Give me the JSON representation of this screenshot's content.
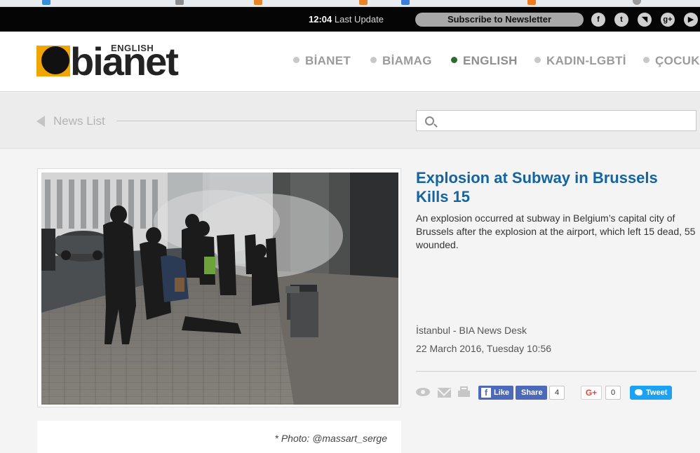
{
  "topbar": {
    "time": "12:04",
    "last_update": "Last Update",
    "subscribe": "Subscribe to Newsletter",
    "social": [
      {
        "name": "facebook-icon",
        "glyph": "f"
      },
      {
        "name": "twitter-icon",
        "glyph": "t"
      },
      {
        "name": "rss-icon",
        "glyph": "◥"
      },
      {
        "name": "googleplus-icon",
        "glyph": "g+"
      },
      {
        "name": "youtube-icon",
        "glyph": "▶"
      }
    ]
  },
  "logo": {
    "edition": "ENGLISH",
    "word": "bianet"
  },
  "nav": [
    "BİANET",
    "BİAMAG",
    "ENGLISH",
    "KADIN-LGBTİ",
    "ÇOCUK"
  ],
  "nav_active": "ENGLISH",
  "newslist": "News List",
  "search": {
    "placeholder": ""
  },
  "article": {
    "title": "Explosion at Subway in Brussels Kills 15",
    "summary": "An explosion occurred at subway in Belgium’s capital city of Brussels after the explosion at the airport, which left 15 dead, 55 wounded.",
    "location": "İstanbul - BIA News Desk",
    "date": "22 March 2016, Tuesday 10:56",
    "photo_caption": "* Photo: @massart_serge"
  },
  "share": {
    "like": "Like",
    "share": "Share",
    "share_count": "4",
    "gplus": "G+",
    "gplus_count": "0",
    "tweet": "Tweet"
  },
  "colors": {
    "accent": "#14659f",
    "logo_orange": "#f0a500",
    "nav_active_dot": "#2f6a2f"
  }
}
